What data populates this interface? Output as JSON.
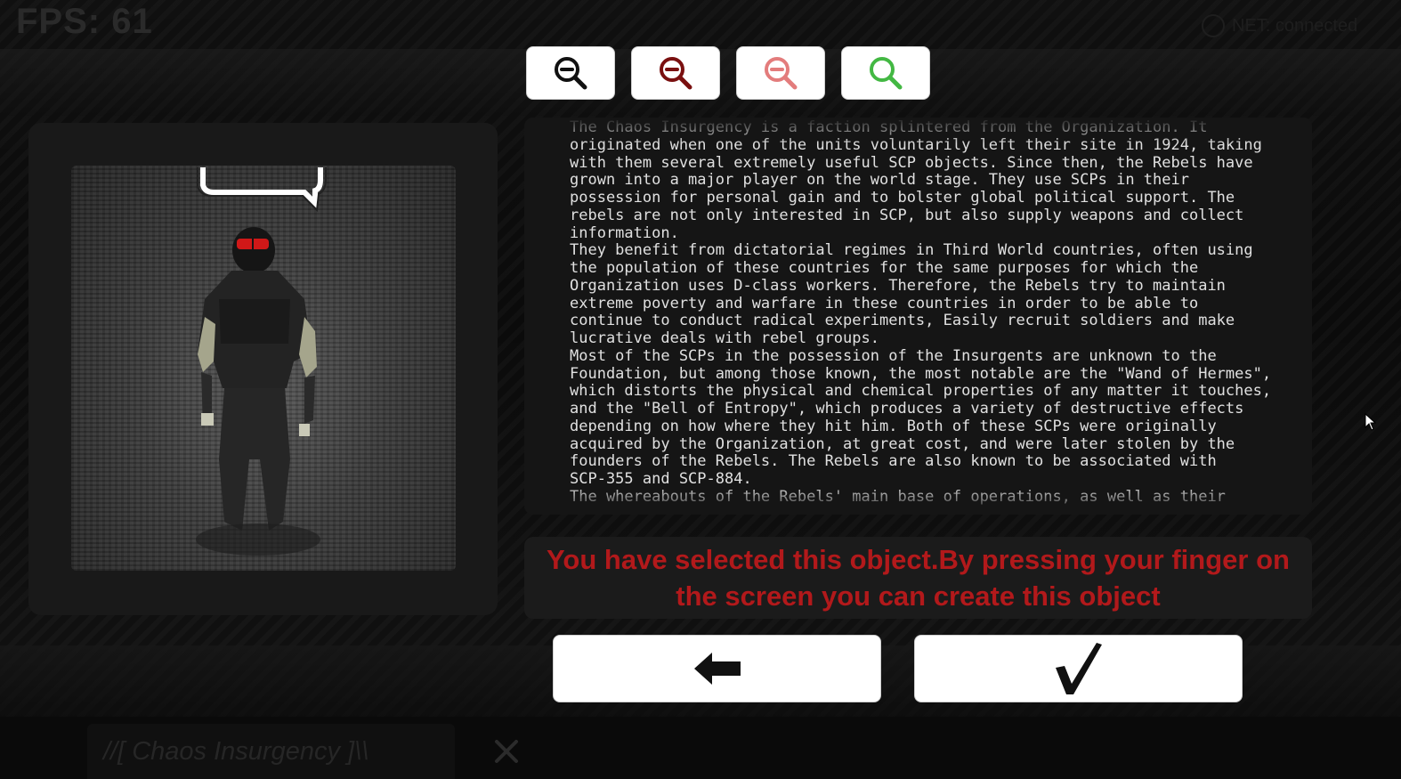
{
  "hud": {
    "fps_text": "FPS: 61",
    "net_status": "NET: connected"
  },
  "zoom_buttons": [
    {
      "name": "zoom-out-black",
      "color": "#111111"
    },
    {
      "name": "zoom-out-darkred",
      "color": "#7a1010"
    },
    {
      "name": "zoom-out-lightred",
      "color": "#e37c7c"
    },
    {
      "name": "zoom-green",
      "color": "#43b843"
    }
  ],
  "description": {
    "text": "The Chaos Insurgency is a faction splintered from the Organization. It\noriginated when one of the units voluntarily left their site in 1924, taking\nwith them several extremely useful SCP objects. Since then, the Rebels have\ngrown into a major player on the world stage. They use SCPs in their\npossession for personal gain and to bolster global political support. The\nrebels are not only interested in SCP, but also supply weapons and collect\ninformation.\nThey benefit from dictatorial regimes in Third World countries, often using\nthe population of these countries for the same purposes for which the\nOrganization uses D-class workers. Therefore, the Rebels try to maintain\nextreme poverty and warfare in these countries in order to be able to\ncontinue to conduct radical experiments, Easily recruit soldiers and make\nlucrative deals with rebel groups.\nMost of the SCPs in the possession of the Insurgents are unknown to the\nFoundation, but among those known, the most notable are the \"Wand of Hermes\",\nwhich distorts the physical and chemical properties of any matter it touches,\nand the \"Bell of Entropy\", which produces a variety of destructive effects\ndepending on how where they hit him. Both of these SCPs were originally\nacquired by the Organization, at great cost, and were later stolen by the\nfounders of the Rebels. The Rebels are also known to be associated with\nSCP-355 and SCP-884.\nThe whereabouts of the Rebels' main base of operations, as well as their"
  },
  "message": {
    "text": "You have selected this object.By pressing your finger on the screen you can create this object",
    "color": "#b2191b"
  },
  "actions": {
    "back_icon": "arrow-left-icon",
    "confirm_icon": "checkmark-icon"
  },
  "object": {
    "title": "//[ Chaos Insurgency ]\\\\"
  },
  "colors": {
    "panel": "#191919",
    "text": "#e0e0e0"
  }
}
